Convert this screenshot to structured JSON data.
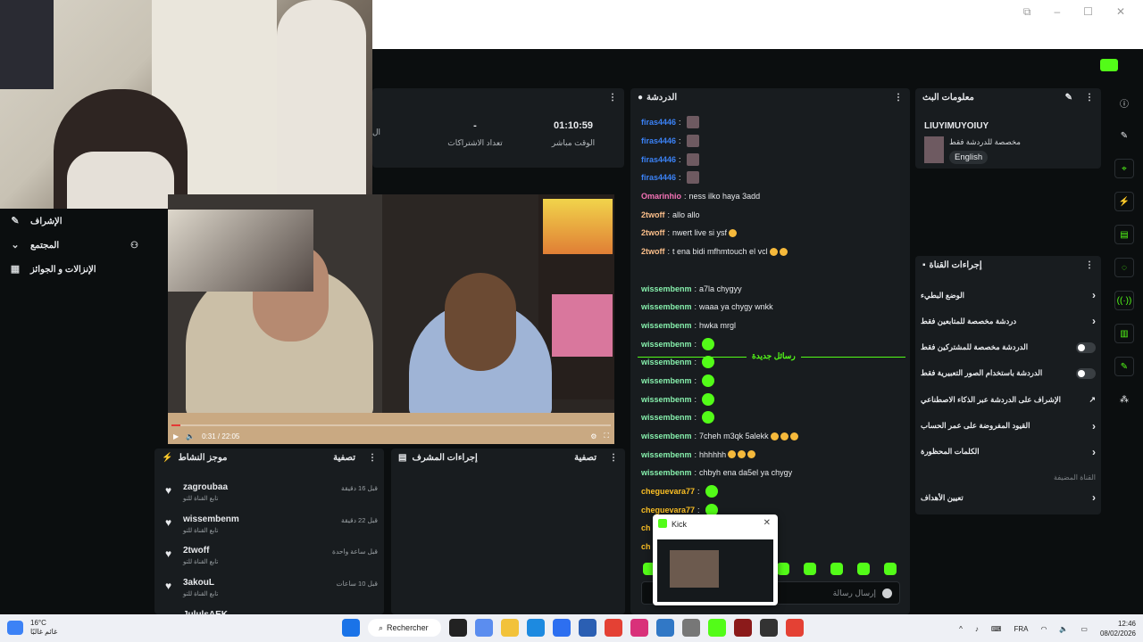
{
  "window": {
    "icons": [
      "picture-in-picture-icon",
      "minimize-icon",
      "maximize-icon",
      "close-icon"
    ]
  },
  "accent": "#53fc18",
  "left_nav": {
    "items": [
      {
        "label": "الإشراف",
        "icon": "wrench-icon"
      },
      {
        "label": "المجتمع",
        "icon": "chevron-down-icon",
        "right_icon": "users-icon"
      },
      {
        "label": "الإنزالات و الجوائز",
        "icon": "gift-icon"
      }
    ]
  },
  "stats": {
    "stats": [
      {
        "value": "01:10:59",
        "label": "الوقت مباشر"
      },
      {
        "value": "-",
        "label": "تعداد الاشتراكات"
      },
      {
        "value": "",
        "label": "ال"
      }
    ]
  },
  "video": {
    "time": "0:31 / 22:05"
  },
  "chat": {
    "title": "الدردشة",
    "divider": "رسائل جديدة",
    "messages": [
      {
        "user": "firas4446",
        "color": "#3b82f6",
        "text": "",
        "emotes": 1,
        "pfp": true
      },
      {
        "user": "firas4446",
        "color": "#3b82f6",
        "text": "",
        "emotes": 1,
        "pfp": true
      },
      {
        "user": "firas4446",
        "color": "#3b82f6",
        "text": "",
        "emotes": 1,
        "pfp": true
      },
      {
        "user": "firas4446",
        "color": "#3b82f6",
        "text": "",
        "emotes": 1,
        "pfp": true
      },
      {
        "user": "Omarinhio",
        "color": "#f472b6",
        "text": "ness ilko haya 3add",
        "emotes": 0
      },
      {
        "user": "2twoff",
        "color": "#fbbf8a",
        "text": "allo allo",
        "emotes": 0
      },
      {
        "user": "2twoff",
        "color": "#fbbf8a",
        "text": "nwert live si ysf",
        "emotes": 0,
        "emoji": 1
      },
      {
        "user": "2twoff",
        "color": "#fbbf8a",
        "text": "t ena bidi mfhmtouch el vcl",
        "emotes": 0,
        "emoji": 2
      },
      {
        "user": "",
        "color": "",
        "text": "",
        "emotes": 0
      },
      {
        "user": "wissembenm",
        "color": "#86efac",
        "text": "a7la chygyy",
        "emotes": 0
      },
      {
        "user": "wissembenm",
        "color": "#86efac",
        "text": "waaa ya chygy wnkk",
        "emotes": 0
      },
      {
        "user": "wissembenm",
        "color": "#86efac",
        "text": "hwka mrgl",
        "emotes": 0
      },
      {
        "user": "wissembenm",
        "color": "#86efac",
        "text": "",
        "emotes": 1
      },
      {
        "user": "wissembenm",
        "color": "#86efac",
        "text": "",
        "emotes": 1
      },
      {
        "user": "wissembenm",
        "color": "#86efac",
        "text": "",
        "emotes": 1
      },
      {
        "user": "wissembenm",
        "color": "#86efac",
        "text": "",
        "emotes": 1
      },
      {
        "user": "wissembenm",
        "color": "#86efac",
        "text": "",
        "emotes": 1
      },
      {
        "user": "wissembenm",
        "color": "#86efac",
        "text": "7cheh m3qk 5alekk",
        "emotes": 0,
        "emoji": 3
      },
      {
        "user": "wissembenm",
        "color": "#86efac",
        "text": "hhhhhh",
        "emotes": 0,
        "emoji": 3
      },
      {
        "user": "wissembenm",
        "color": "#86efac",
        "text": "chbyh ena da5el ya chygy",
        "emotes": 0
      },
      {
        "user": "cheguevara77",
        "color": "#fbbf24",
        "text": "",
        "emotes": 1
      },
      {
        "user": "cheguevara77",
        "color": "#fbbf24",
        "text": "",
        "emotes": 1
      },
      {
        "user": "ch",
        "color": "#fbbf24",
        "text": "",
        "emotes": 0
      },
      {
        "user": "ch",
        "color": "#fbbf24",
        "text": "",
        "emotes": 0
      }
    ],
    "input_placeholder": "إرسال رسالة"
  },
  "kick_popup": {
    "title": "Kick"
  },
  "stream_info": {
    "title": "معلومات البث",
    "stream_title": "LIUYIMUYOIUY",
    "category": "مخصصة للدردشة فقط",
    "language": "English"
  },
  "channel_actions": {
    "title": "إجراءات القناة",
    "rows": [
      {
        "label": "الوضع البطيء",
        "type": "chevron"
      },
      {
        "label": "دردشة مخصصة للمتابعين فقط",
        "type": "chevron"
      },
      {
        "label": "الدردشة مخصصة للمشتركين فقط",
        "type": "toggle"
      },
      {
        "label": "الدردشة باستخدام الصور التعبيرية فقط",
        "type": "toggle"
      },
      {
        "label": "الإشراف على الدردشة عبر الذكاء الاصطناعي",
        "type": "external"
      },
      {
        "label": "القيود المفروضة على عمر الحساب",
        "type": "chevron"
      },
      {
        "label": "الكلمات المحظورة",
        "type": "chevron"
      }
    ],
    "section_label": "القناة المضيفة",
    "host_row": "تعيين الأهداف"
  },
  "right_strip": [
    "info-icon",
    "pencil-icon",
    "target-icon",
    "bolt-icon",
    "document-icon",
    "chat-icon",
    "broadcast-icon",
    "layout-icon",
    "wrench-icon",
    "cluster-icon"
  ],
  "activity": {
    "title": "موجز النشاط",
    "filter": "تصفية",
    "items": [
      {
        "name": "zagroubaa",
        "sub": "تابع القناة للتو",
        "time": "قبل 16 دقيقة"
      },
      {
        "name": "wissembenm",
        "sub": "تابع القناة للتو",
        "time": "قبل 22 دقيقة"
      },
      {
        "name": "2twoff",
        "sub": "تابع القناة للتو",
        "time": "قبل ساعة واحدة"
      },
      {
        "name": "3akouL",
        "sub": "تابع القناة للتو",
        "time": "قبل 10 ساعات"
      },
      {
        "name": "JululsAEK",
        "sub": "",
        "time": ""
      }
    ]
  },
  "mod_actions": {
    "title": "إجراءات المشرف",
    "filter": "تصفية"
  },
  "taskbar": {
    "weather_temp": "16°C",
    "weather_desc": "غائم غالبًا",
    "search": "Rechercher",
    "lang": "FRA",
    "time": "12:46",
    "date": "08/02/2026"
  }
}
